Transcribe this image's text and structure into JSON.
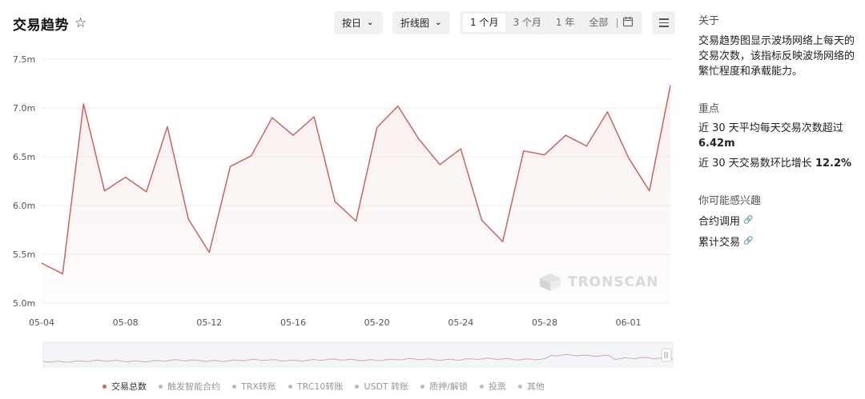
{
  "header": {
    "title": "交易趋势",
    "granularity": "按日",
    "chart_type_select": "折线图",
    "range_options": [
      "1 个月",
      "3 个月",
      "1 年",
      "全部"
    ],
    "active_range": "1 个月"
  },
  "watermark": "TRONSCAN",
  "legend": [
    "交易总数",
    "触发智能合约",
    "TRX转账",
    "TRC10转账",
    "USDT 转账",
    "质押/解锁",
    "投票",
    "其他"
  ],
  "sidebar": {
    "about_title": "关于",
    "about_text": "交易趋势图显示波场网络上每天的交易次数，该指标反映波场网络的繁忙程度和承载能力。",
    "highlights_title": "重点",
    "h1_text": "近 30 天平均每天交易次数超过 ",
    "h1_value": "6.42m",
    "h2_text": "近 30 天交易数环比增长 ",
    "h2_value": "12.2%",
    "interest_title": "你可能感兴趣",
    "links": [
      "合约调用",
      "累计交易"
    ]
  },
  "chart_data": {
    "type": "line",
    "x": [
      "05-04",
      "05-05",
      "05-06",
      "05-07",
      "05-08",
      "05-09",
      "05-10",
      "05-11",
      "05-12",
      "05-13",
      "05-14",
      "05-15",
      "05-16",
      "05-17",
      "05-18",
      "05-19",
      "05-20",
      "05-21",
      "05-22",
      "05-23",
      "05-24",
      "05-25",
      "05-26",
      "05-27",
      "05-28",
      "05-29",
      "05-30",
      "05-31",
      "06-01",
      "06-02",
      "06-03"
    ],
    "series": [
      {
        "name": "交易总数",
        "values": [
          5.41,
          5.3,
          7.04,
          6.15,
          6.29,
          6.14,
          6.81,
          5.86,
          5.52,
          6.4,
          6.51,
          6.9,
          6.72,
          6.91,
          6.04,
          5.84,
          6.8,
          7.02,
          6.68,
          6.42,
          6.58,
          5.85,
          5.63,
          6.56,
          6.52,
          6.72,
          6.61,
          6.96,
          6.49,
          6.15,
          7.23
        ]
      }
    ],
    "y_ticks": [
      "5.0m",
      "5.5m",
      "6.0m",
      "6.5m",
      "7.0m",
      "7.5m"
    ],
    "x_ticks": [
      "05-04",
      "05-08",
      "05-12",
      "05-16",
      "05-20",
      "05-24",
      "05-28",
      "06-01"
    ],
    "ylim": [
      5.0,
      7.5
    ],
    "line_color": "#c9645f",
    "grid": true
  }
}
